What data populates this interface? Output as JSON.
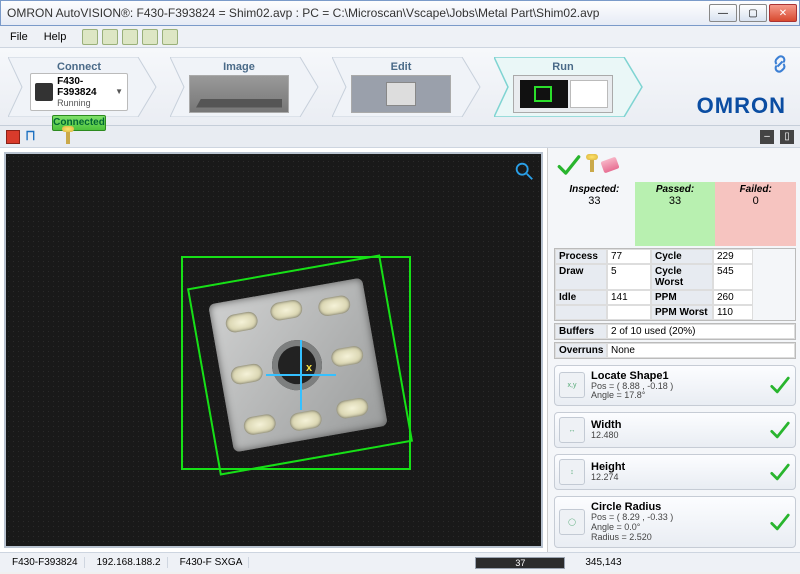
{
  "title": "OMRON AutoVISION®: F430-F393824 = Shim02.avp  :  PC = C:\\Microscan\\Vscape\\Jobs\\Metal Part\\Shim02.avp",
  "menu": {
    "file": "File",
    "help": "Help"
  },
  "steps": {
    "connect": "Connect",
    "image": "Image",
    "edit": "Edit",
    "run": "Run"
  },
  "brand": "OMRON",
  "device": {
    "name": "F430-F393824",
    "status": "Running",
    "pill": "Connected"
  },
  "counters": {
    "inspected_label": "Inspected:",
    "inspected": "33",
    "passed_label": "Passed:",
    "passed": "33",
    "failed_label": "Failed:",
    "failed": "0"
  },
  "stats": {
    "process_h": "Process",
    "process": "77",
    "cycle_h": "Cycle",
    "cycle": "229",
    "draw_h": "Draw",
    "draw": "5",
    "cycleworst_h": "Cycle Worst",
    "cycleworst": "545",
    "idle_h": "Idle",
    "idle": "141",
    "ppm_h": "PPM",
    "ppm": "260",
    "blank_h": "",
    "blank": "",
    "ppmworst_h": "PPM Worst",
    "ppmworst": "110",
    "buffers_h": "Buffers",
    "buffers": "2 of 10 used (20%)",
    "overruns_h": "Overruns",
    "overruns": "None"
  },
  "results": [
    {
      "title": "Locate Shape1",
      "line1": "Pos = ( 8.88 , -0.18 )",
      "line2": "Angle = 17.8°"
    },
    {
      "title": "Width",
      "line1": "12.480",
      "line2": ""
    },
    {
      "title": "Height",
      "line1": "12.274",
      "line2": ""
    },
    {
      "title": "Circle Radius",
      "line1": "Pos = ( 8.29 , -0.33 )",
      "line2": "Angle = 0.0°",
      "line3": "Radius = 2.520"
    }
  ],
  "overlay": {
    "axis": "x"
  },
  "statusbar": {
    "dev": "F430-F393824",
    "ip": "192.168.188.2",
    "mode": "F430-F SXGA",
    "progress": "37",
    "coords": "345,143"
  }
}
